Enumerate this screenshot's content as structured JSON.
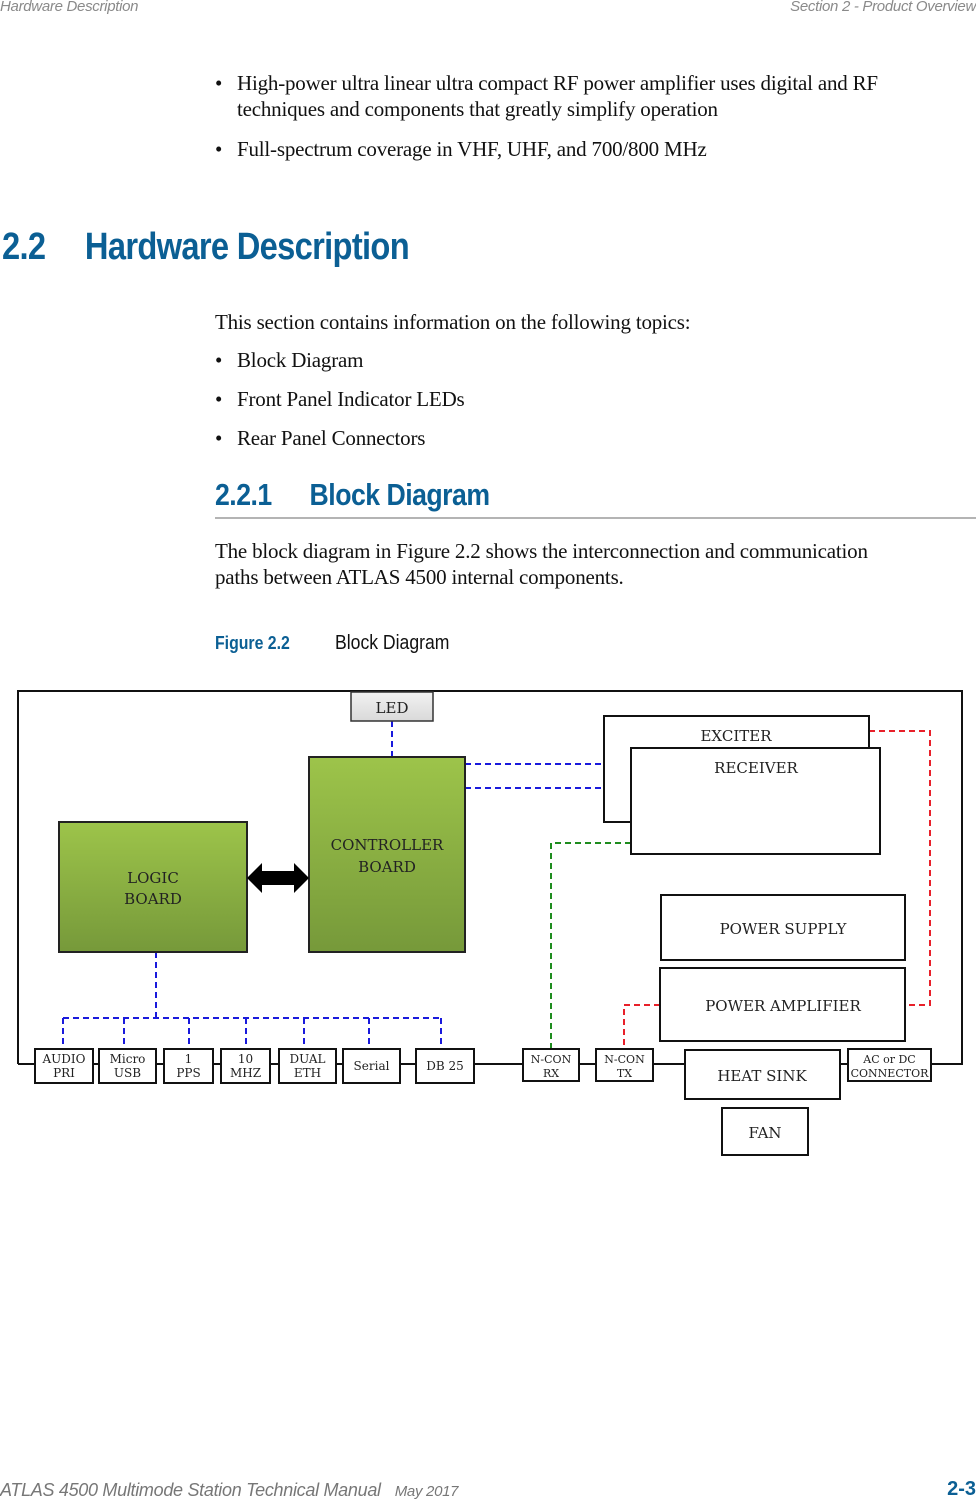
{
  "header": {
    "left": "Hardware Description",
    "right": "Section 2 - Product Overview"
  },
  "intro_bullets": [
    {
      "line1": "High-power ultra linear ultra compact RF power amplifier uses digital and RF",
      "line2": "techniques and components that greatly simplify operation"
    },
    {
      "line1": "Full-spectrum coverage in VHF, UHF, and 700/800 MHz",
      "line2": ""
    }
  ],
  "bullet_glyph": "•",
  "section": {
    "number": "2.2",
    "title": "Hardware Description",
    "intro": "This section contains information on the following topics:",
    "topics": [
      "Block Diagram",
      "Front Panel Indicator LEDs",
      "Rear Panel Connectors"
    ]
  },
  "subsection": {
    "number": "2.2.1",
    "title": "Block Diagram",
    "paragraph_line1": "The block diagram in Figure 2.2 shows the interconnection and communication",
    "paragraph_line2": "paths between ATLAS 4500 internal components."
  },
  "figure": {
    "label": "Figure 2.2",
    "title": "Block Diagram"
  },
  "diagram": {
    "colors": {
      "board_green_top": "#9dc44a",
      "board_green_bottom": "#76993a",
      "led_gray": "#d9d9d9",
      "link_blue": "#1a1adc",
      "link_red": "#e8202a",
      "link_green": "#1e8c1e",
      "frame": "#111111"
    },
    "blocks": {
      "led": "LED",
      "exciter": "EXCITER",
      "receiver": "RECEIVER",
      "logic_board": [
        "LOGIC",
        "BOARD"
      ],
      "controller_board": [
        "CONTROLLER",
        "BOARD"
      ],
      "power_supply": "POWER SUPPLY",
      "power_amplifier": "POWER AMPLIFIER",
      "heat_sink": "HEAT SINK",
      "fan": "FAN"
    },
    "connectors": [
      {
        "l1": "AUDIO",
        "l2": "PRI"
      },
      {
        "l1": "Micro",
        "l2": "USB"
      },
      {
        "l1": "1",
        "l2": "PPS"
      },
      {
        "l1": "10",
        "l2": "MHZ"
      },
      {
        "l1": "DUAL",
        "l2": "ETH"
      },
      {
        "l1": "Serial",
        "l2": ""
      },
      {
        "l1": "DB 25",
        "l2": ""
      },
      {
        "l1": "N-CON",
        "l2": "RX"
      },
      {
        "l1": "N-CON",
        "l2": "TX"
      },
      {
        "l1": "AC or DC",
        "l2": "CONNECTOR"
      }
    ]
  },
  "footer": {
    "manual": "ATLAS 4500 Multimode Station Technical Manual",
    "date": "May 2017",
    "page": "2-3"
  }
}
